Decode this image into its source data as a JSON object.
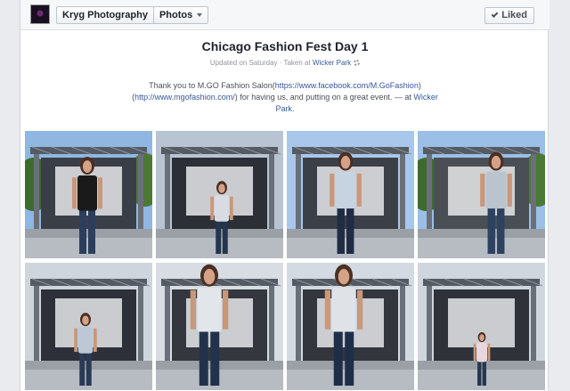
{
  "header": {
    "page_name": "Kryg Photography",
    "section": "Photos",
    "liked_label": "Liked"
  },
  "album": {
    "title": "Chicago Fashion Fest Day 1",
    "updated": "Updated on Saturday",
    "separator": " · ",
    "taken_prefix": "Taken at ",
    "location": "Wicker Park",
    "description_parts": {
      "t1": "Thank you to M.GO Fashion Salon(",
      "link1": "https://www.facebook.com/M.GoFashion",
      "t2": ") (",
      "link2": "http://www.mgofashion.com/",
      "t3": ") for having us, and putting on a great event. — at ",
      "location": "Wicker Park",
      "t4": "."
    }
  },
  "photos": [
    {
      "sky": "#8fb7e2",
      "top": "#1a1a1a",
      "pants": "#2c3e5c",
      "bg": "#3a3f47",
      "trees": true
    },
    {
      "sky": "#b8c4d2",
      "top": "#d8dce2",
      "pants": "#24354f",
      "bg": "#2c2f36",
      "trees": false
    },
    {
      "sky": "#a9c7ea",
      "top": "#c6d3e0",
      "pants": "#1f2c44",
      "bg": "#3b4048",
      "trees": false
    },
    {
      "sky": "#9bbfe6",
      "top": "#b9c4cf",
      "pants": "#2d4161",
      "bg": "#4a4f55",
      "trees": true
    },
    {
      "sky": "#cfd5dc",
      "top": "#bcc8d6",
      "pants": "#2a3a55",
      "bg": "#2d3038",
      "trees": false
    },
    {
      "sky": "#d7dde3",
      "top": "#e2e5ea",
      "pants": "#22324c",
      "bg": "#34373e",
      "trees": false
    },
    {
      "sky": "#d4dae1",
      "top": "#dfe3e8",
      "pants": "#1e2e49",
      "bg": "#33363d",
      "trees": false
    },
    {
      "sky": "#cfd6de",
      "top": "#e8d7de",
      "pants": "#26364f",
      "bg": "#2f3239",
      "trees": false
    }
  ]
}
